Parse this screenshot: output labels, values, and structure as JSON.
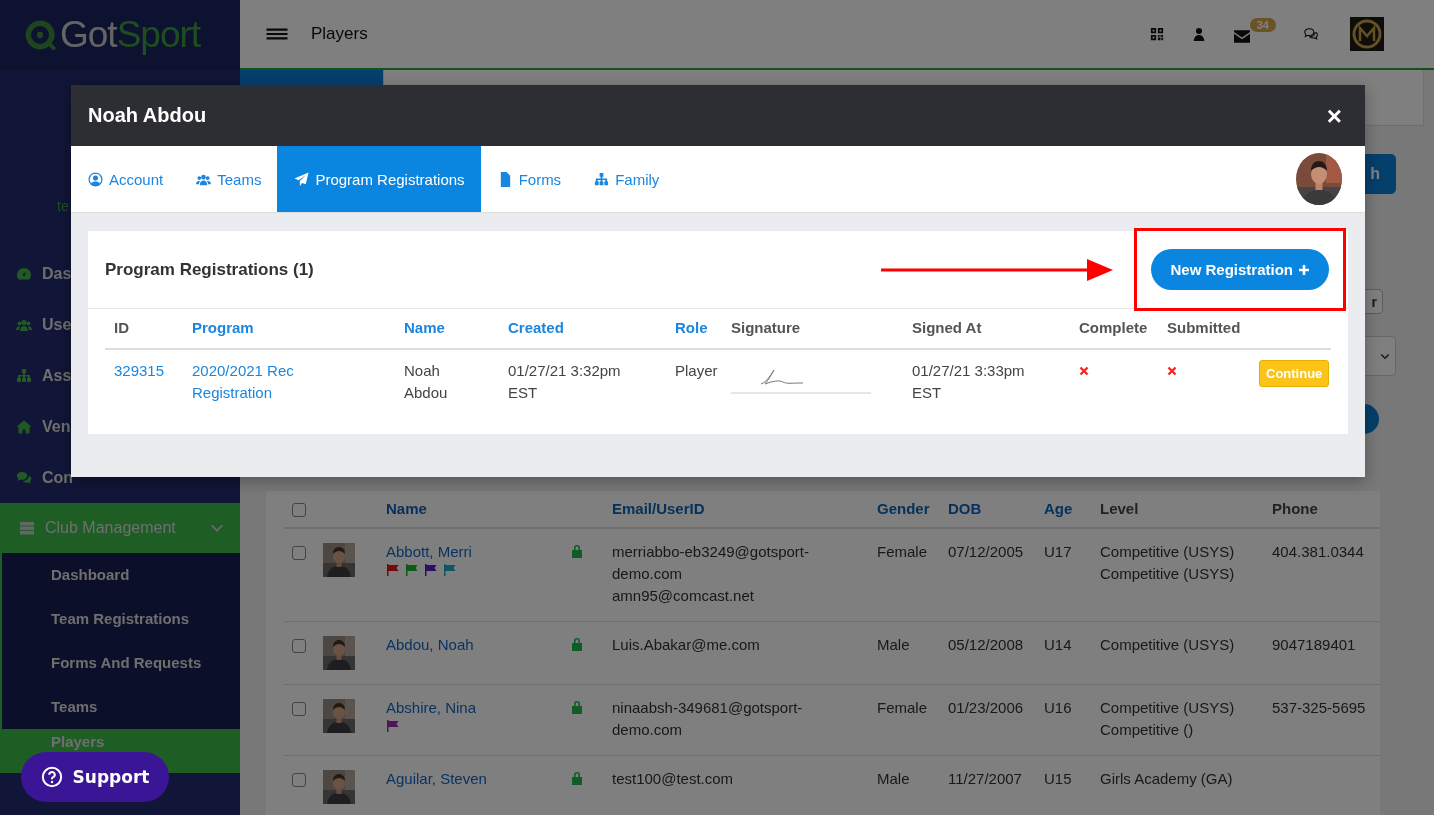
{
  "sidebar": {
    "logo": [
      "Got",
      "Sport"
    ],
    "user_text": "te",
    "items": [
      {
        "label": "Das"
      },
      {
        "label": "Use"
      },
      {
        "label": "Ass"
      },
      {
        "label": "Ven"
      },
      {
        "label": "Con"
      }
    ],
    "group": {
      "label": "Club Management",
      "expanded": true,
      "children": [
        {
          "label": "Dashboard",
          "selected": false
        },
        {
          "label": "Team Registrations",
          "selected": false
        },
        {
          "label": "Forms And Requests",
          "selected": false
        },
        {
          "label": "Teams",
          "selected": false
        },
        {
          "label": "Players",
          "selected": true
        }
      ]
    }
  },
  "support_button": "Support",
  "header": {
    "title": "Players",
    "badge": "34"
  },
  "background": {
    "search_button": "h",
    "clear_button": "r"
  },
  "players_table": {
    "select_all_checked": false,
    "columns": [
      {
        "label": "Name",
        "sortable": true
      },
      {
        "label": "Email/UserID",
        "sortable": true
      },
      {
        "label": "Gender",
        "sortable": true
      },
      {
        "label": "DOB",
        "sortable": true
      },
      {
        "label": "Age",
        "sortable": true
      },
      {
        "label": "Level",
        "sortable": false
      },
      {
        "label": "Phone",
        "sortable": false
      }
    ],
    "rows": [
      {
        "checked": false,
        "name": "Abbott, Merri",
        "flags": [
          {
            "color": "#710a0d"
          },
          {
            "color": "#0c5c16"
          },
          {
            "color": "#2d0e67"
          },
          {
            "color": "#115464"
          }
        ],
        "locked": true,
        "emails": [
          "merriabbo-eb3249@gotsport-demo.com",
          "amn95@comcast.net"
        ],
        "gender": "Female",
        "dob": "07/12/2005",
        "age": "U17",
        "levels": [
          "Competitive (USYS)",
          "Competitive (USYS)"
        ],
        "phone": "404.381.0344"
      },
      {
        "checked": false,
        "name": "Abdou, Noah",
        "flags": [],
        "locked": true,
        "emails": [
          "Luis.Abakar@me.com"
        ],
        "gender": "Male",
        "dob": "05/12/2008",
        "age": "U14",
        "levels": [
          "Competitive (USYS)"
        ],
        "phone": "9047189401"
      },
      {
        "checked": false,
        "name": "Abshire, Nina",
        "flags": [
          {
            "color": "#4e1558"
          }
        ],
        "locked": true,
        "emails": [
          "ninaabsh-349681@gotsport-demo.com"
        ],
        "gender": "Female",
        "dob": "01/23/2006",
        "age": "U16",
        "levels": [
          "Competitive (USYS)",
          "Competitive ()"
        ],
        "phone": "537-325-5695"
      },
      {
        "checked": false,
        "name": "Aguilar, Steven",
        "flags": [],
        "locked": true,
        "emails": [
          "test100@test.com"
        ],
        "gender": "Male",
        "dob": "11/27/2007",
        "age": "U15",
        "levels": [
          "Girls Academy (GA)"
        ]
      }
    ]
  },
  "modal": {
    "title": "Noah Abdou",
    "close": "×",
    "tabs": [
      {
        "label": "Account",
        "selected": false
      },
      {
        "label": "Teams",
        "selected": false
      },
      {
        "label": "Program Registrations",
        "selected": true
      },
      {
        "label": "Forms",
        "selected": false
      },
      {
        "label": "Family",
        "selected": false
      }
    ],
    "card": {
      "title": "Program Registrations (1)",
      "new_button": "New Registration",
      "columns": [
        {
          "label": "ID",
          "sortable": false
        },
        {
          "label": "Program",
          "sortable": true
        },
        {
          "label": "Name",
          "sortable": true
        },
        {
          "label": "Created",
          "sortable": true
        },
        {
          "label": "Role",
          "sortable": true
        },
        {
          "label": "Signature",
          "sortable": false
        },
        {
          "label": "Signed At",
          "sortable": false
        },
        {
          "label": "Complete",
          "sortable": false
        },
        {
          "label": "Submitted",
          "sortable": false
        }
      ],
      "rows": [
        {
          "id": "329315",
          "program": "2020/2021 Rec Registration",
          "name": "Noah Abdou",
          "created": "01/27/21 3:32pm EST",
          "role": "Player",
          "signed_at": "01/27/21 3:33pm EST",
          "complete": false,
          "submitted": false,
          "action": "Continue"
        }
      ]
    }
  }
}
